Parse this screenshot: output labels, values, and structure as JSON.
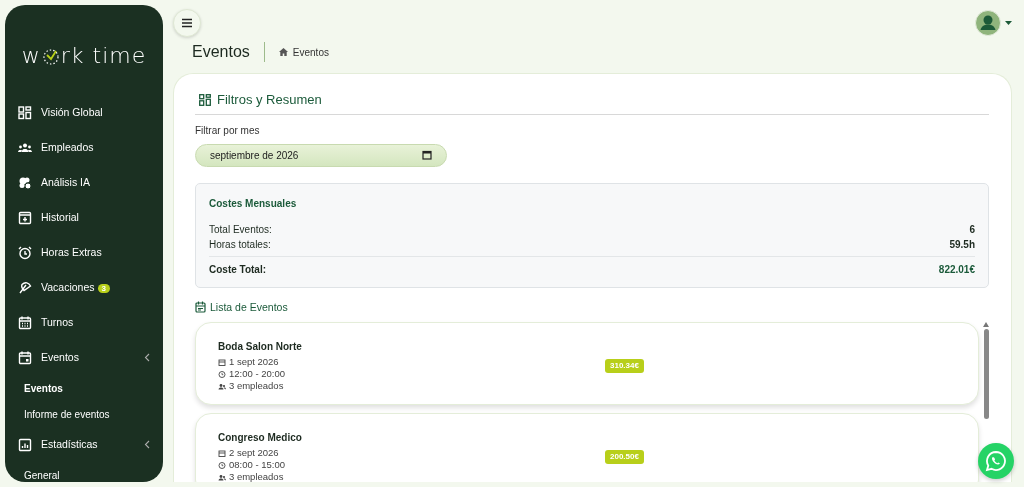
{
  "logo": {
    "before": "w",
    "after": "rk time"
  },
  "sidebar": {
    "items": [
      {
        "label": "Visión Global"
      },
      {
        "label": "Empleados"
      },
      {
        "label": "Análisis IA"
      },
      {
        "label": "Historial"
      },
      {
        "label": "Horas Extras"
      },
      {
        "label": "Vacaciones",
        "badge": "3"
      },
      {
        "label": "Turnos"
      },
      {
        "label": "Eventos",
        "expanded": true,
        "children": [
          {
            "label": "Eventos",
            "selected": true
          },
          {
            "label": "Informe de eventos",
            "selected": false
          }
        ]
      },
      {
        "label": "Estadísticas",
        "expanded": true,
        "children": [
          {
            "label": "General",
            "selected": false
          }
        ]
      }
    ]
  },
  "page_title": "Eventos",
  "breadcrumb": "Eventos",
  "filters": {
    "title": "Filtros y Resumen",
    "month_label": "Filtrar por mes",
    "month_value": "septiembre de 2026"
  },
  "summary": {
    "title": "Costes Mensuales",
    "rows": [
      {
        "label": "Total Eventos:",
        "value": "6",
        "kind": "plain"
      },
      {
        "label": "Horas totales:",
        "value": "59.5h",
        "kind": "plain"
      },
      {
        "label": "Coste Total:",
        "value": "822.01€",
        "kind": "total"
      }
    ]
  },
  "events_title": "Lista de Eventos",
  "events": [
    {
      "name": "Boda Salon Norte",
      "date": "1 sept 2026",
      "time": "12:00 - 20:00",
      "staff": "3 empleados",
      "cost": "310.34€"
    },
    {
      "name": "Congreso Medico",
      "date": "2 sept 2026",
      "time": "08:00 - 15:00",
      "staff": "3 empleados",
      "cost": "200.50€"
    }
  ]
}
